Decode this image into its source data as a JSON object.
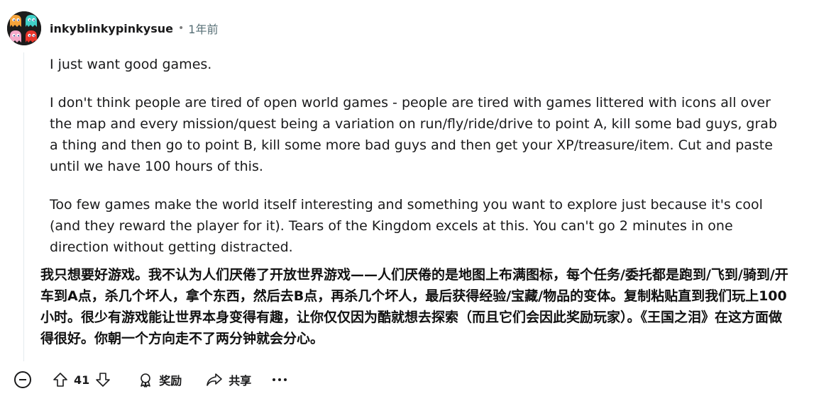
{
  "comment": {
    "username": "inkyblinkypinkysue",
    "separator": "•",
    "timestamp": "1年前",
    "paragraphs": [
      "I just want good games.",
      "I don't think people are tired of open world games - people are tired with games littered with icons all over the map and every mission/quest being a variation on run/fly/ride/drive to point A, kill some bad guys, grab a thing and then go to point B, kill some more bad guys and then get your XP/treasure/item. Cut and paste until we have 100 hours of this.",
      "Too few games make the world itself interesting and something you want to explore just because it's cool (and they reward the player for it). Tears of the Kingdom excels at this. You can't go 2 minutes in one direction without getting distracted."
    ],
    "translation": "我只想要好游戏。我不认为人们厌倦了开放世界游戏——人们厌倦的是地图上布满图标，每个任务/委托都是跑到/飞到/骑到/开车到A点，杀几个坏人，拿个东西，然后去B点，再杀几个坏人，最后获得经验/宝藏/物品的变体。复制粘贴直到我们玩上100小时。很少有游戏能让世界本身变得有趣，让你仅仅因为酷就想去探索（而且它们会因此奖励玩家）。《王国之泪》在这方面做得很好。你朝一个方向走不了两分钟就会分心。"
  },
  "actions": {
    "score": "41",
    "award_label": "奖励",
    "share_label": "共享"
  },
  "icons": {
    "collapse": "collapse-circle-icon",
    "upvote": "upvote-arrow-icon",
    "downvote": "downvote-arrow-icon",
    "award": "award-ribbon-icon",
    "share": "share-arrow-icon",
    "more": "more-dots-icon"
  },
  "colors": {
    "avatar_bg": "#1c1c1c",
    "ghost_orange": "#f5a33a",
    "ghost_cyan": "#3fd0c8",
    "ghost_pink": "#f4a7c8",
    "ghost_red": "#e8342b",
    "thread_line": "#e5ebee",
    "timestamp": "#576f76"
  }
}
